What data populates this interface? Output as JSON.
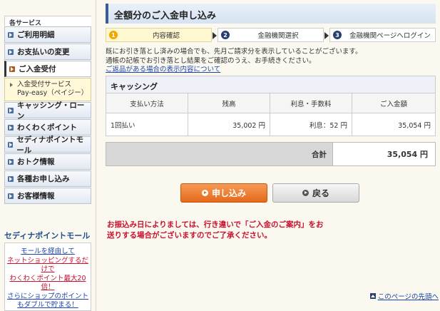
{
  "sidebar": {
    "section_header": "各サービス",
    "items": [
      {
        "label": "ご利用明細"
      },
      {
        "label": "お支払いの変更"
      },
      {
        "label": "ご入金受付"
      },
      {
        "label": "キャッシング・ローン"
      },
      {
        "label": "わくわくポイント"
      },
      {
        "label": "セディナポイントモール"
      },
      {
        "label": "おトク情報"
      },
      {
        "label": "各種お申し込み"
      },
      {
        "label": "お客様情報"
      }
    ],
    "subitem": "入金受付サービス Pay-easy（ペイジー）",
    "mall_title": "セディナポイントモール",
    "mall_lines": [
      "モールを経由して",
      "ネットショッピングするだけで",
      "わくわくポイント最大20倍！",
      "さらにショップのポイントもダブルで貯まる！"
    ]
  },
  "main": {
    "title": "全額分のご入金申し込み",
    "steps": [
      {
        "num": "1",
        "label": "内容確認"
      },
      {
        "num": "2",
        "label": "金融機関選択"
      },
      {
        "num": "3",
        "label": "金融機関ページへログイン"
      }
    ],
    "notice_lines": [
      "既にお引き落とし済みの場合でも、先月ご請求分を表示していることがございます。",
      "通帳の記帳でお引き落とし結果をご確認のうえ、お手続きください。"
    ],
    "notice_link": "ご返品がある場合の表示内容について",
    "table": {
      "title": "キャッシング",
      "headers": [
        "支払い方法",
        "残高",
        "利息・手数料",
        "ご入金額"
      ],
      "row": [
        "1回払い",
        "35,002 円",
        "利息：52 円",
        "35,054 円"
      ]
    },
    "total_label": "合計",
    "total_value": "35,054 円",
    "apply_button": "申し込み",
    "back_button": "戻る",
    "warning_lines": [
      "お振込み日によりましては、行き違いで「ご入金のご案内」をお",
      "送りする場合がございますのでご了承ください。"
    ],
    "page_top_link": "このページの先頭へ"
  }
}
